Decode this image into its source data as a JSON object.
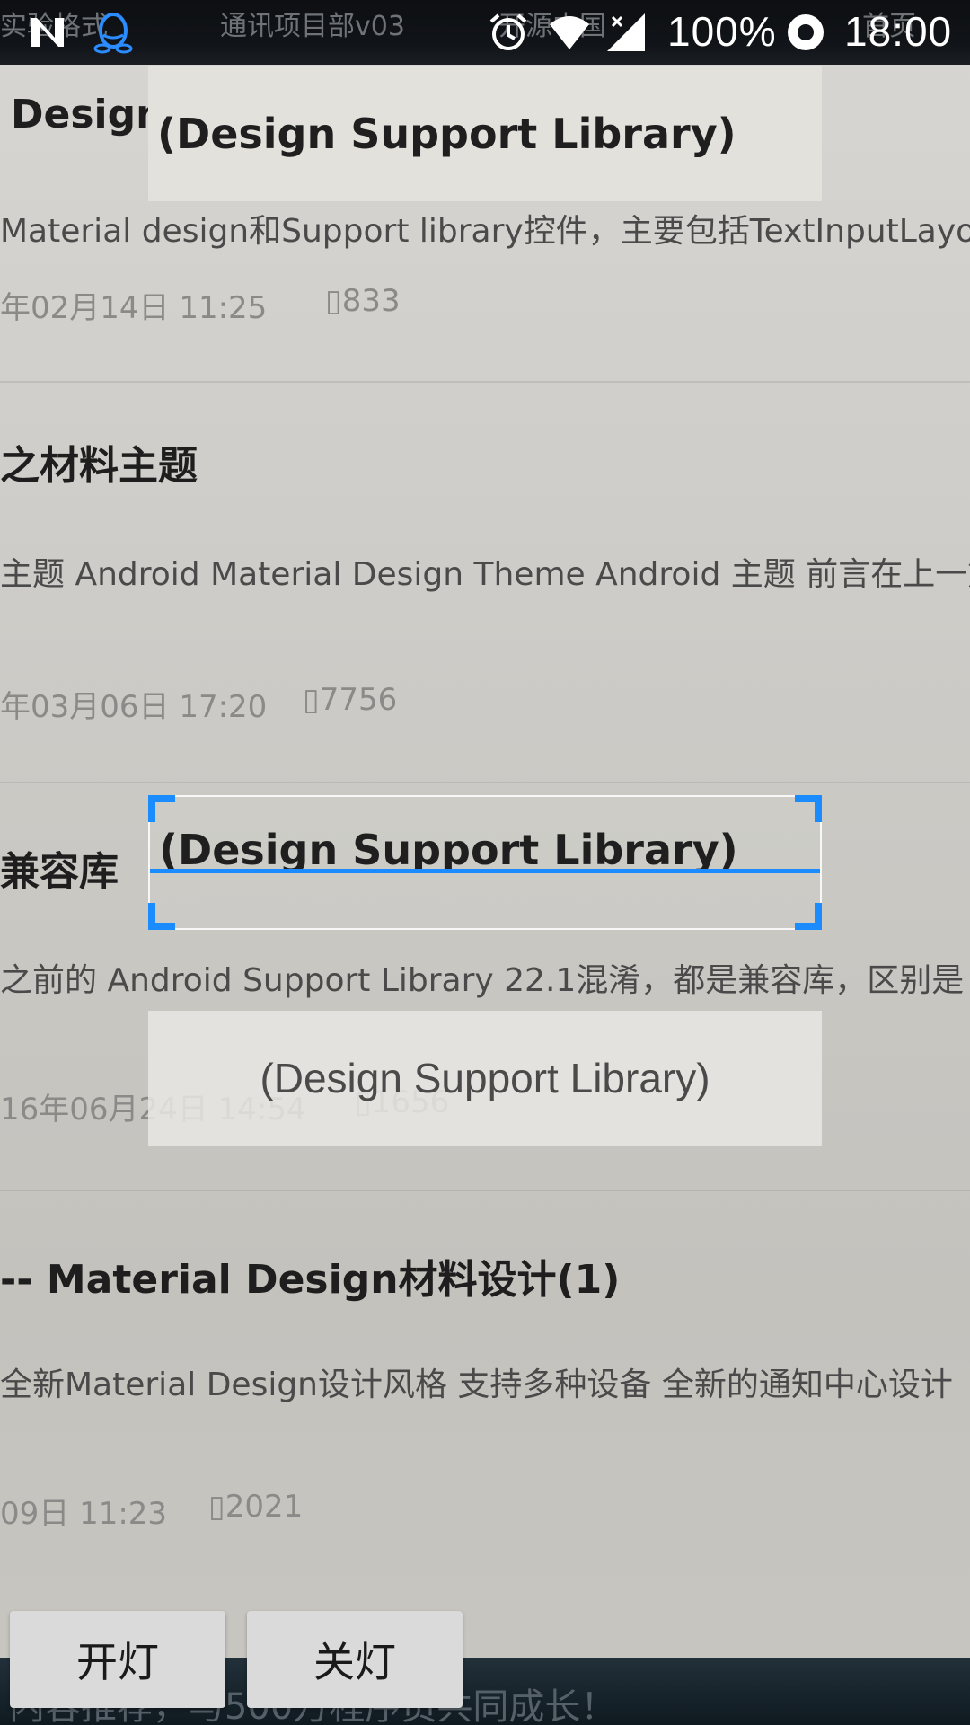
{
  "status_bar": {
    "background_notifications": {
      "left_text": "实验格式",
      "doc_text": "通讯项目部v03",
      "right_text": "开源中国",
      "far_text": "首页"
    },
    "icons": [
      "n-notification-icon",
      "qq-penguin-icon",
      "alarm-icon",
      "wifi-icon",
      "signal-icon"
    ],
    "battery": "100%",
    "time": "18:00"
  },
  "scanner": {
    "top_result": "(Design Support Library)",
    "frame_text": "(Design Support Library)",
    "bottom_result": "(Design Support Library)",
    "accent_color": "#1a8cff"
  },
  "background_article": {
    "items": [
      {
        "title": "Design",
        "excerpt": "Material design和Support library控件，主要包括TextInputLayo",
        "date": "年02月14日 11:25",
        "views": "833"
      },
      {
        "title": "之材料主题",
        "excerpt": "主题 Android Material Design Theme Android 主题 前言在上一篇",
        "date": "年03月06日 17:20",
        "views": "7756"
      },
      {
        "title": "兼容库",
        "excerpt": "之前的 Android Support Library 22.1混淆，都是兼容库，区别是",
        "date": "16年06月24日 14:54",
        "views": "1656"
      },
      {
        "title": "-- Material Design材料设计(1)",
        "excerpt": "全新Material Design设计风格 支持多种设备 全新的通知中心设计",
        "date": "09日 11:23",
        "views": "2021"
      }
    ],
    "footer_text": "内容推荐，与500万程序员共同成长！"
  },
  "buttons": {
    "light_on": "开灯",
    "light_off": "关灯"
  }
}
